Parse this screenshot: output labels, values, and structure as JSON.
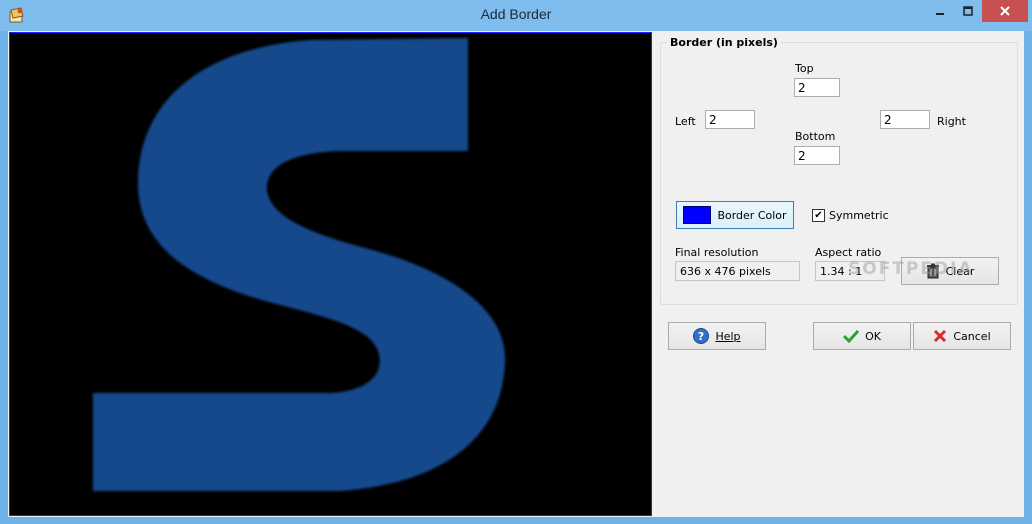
{
  "window": {
    "title": "Add Border"
  },
  "border_group": {
    "title": "Border (in pixels)",
    "top_label": "Top",
    "top_value": "2",
    "left_label": "Left",
    "left_value": "2",
    "right_label": "Right",
    "right_value": "2",
    "bottom_label": "Bottom",
    "bottom_value": "2",
    "border_color_label": "Border Color",
    "border_color": "#0000ff",
    "symmetric_label": "Symmetric",
    "symmetric_checked": true,
    "final_resolution_label": "Final resolution",
    "final_resolution_value": "636 x 476 pixels",
    "aspect_ratio_label": "Aspect ratio",
    "aspect_ratio_value": "1.34 : 1",
    "clear_label": "Clear"
  },
  "buttons": {
    "help_label": "Help",
    "ok_label": "OK",
    "cancel_label": "Cancel"
  },
  "preview": {
    "letter": "S",
    "letter_color": "#124a8c",
    "background": "#000000"
  },
  "watermark": "SOFTPEDIA"
}
